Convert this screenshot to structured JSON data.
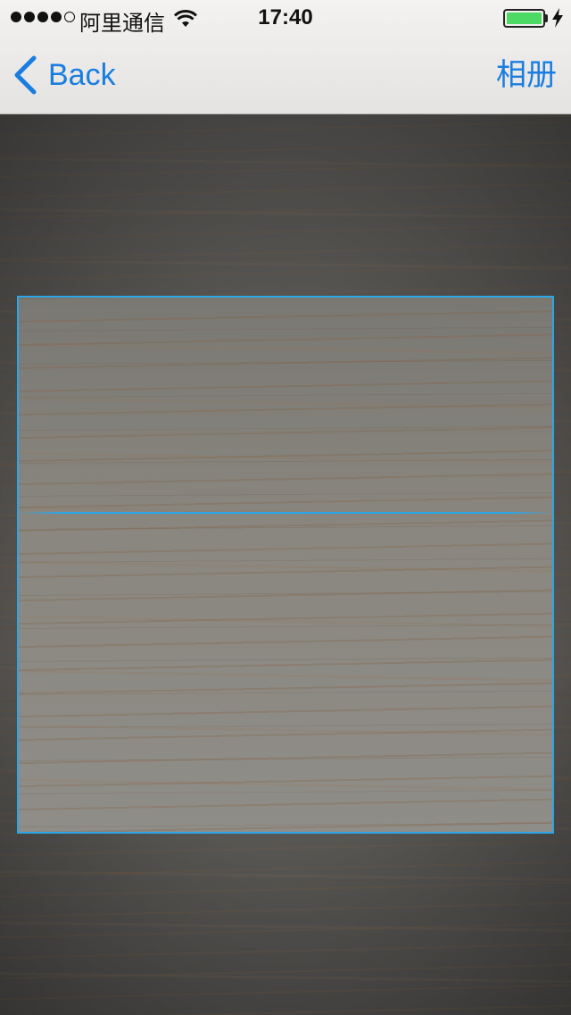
{
  "status_bar": {
    "carrier": "阿里通信",
    "time": "17:40",
    "signal_bars_filled": 4,
    "signal_bars_total": 5,
    "battery_level": 1.0,
    "icons": [
      "signal-icon",
      "wifi-icon",
      "battery-icon",
      "charging-icon"
    ]
  },
  "nav": {
    "back_label": "Back",
    "album_label": "相册",
    "accent_color": "#1a7de0"
  },
  "scanner": {
    "frame_color": "#2aa7e8"
  }
}
